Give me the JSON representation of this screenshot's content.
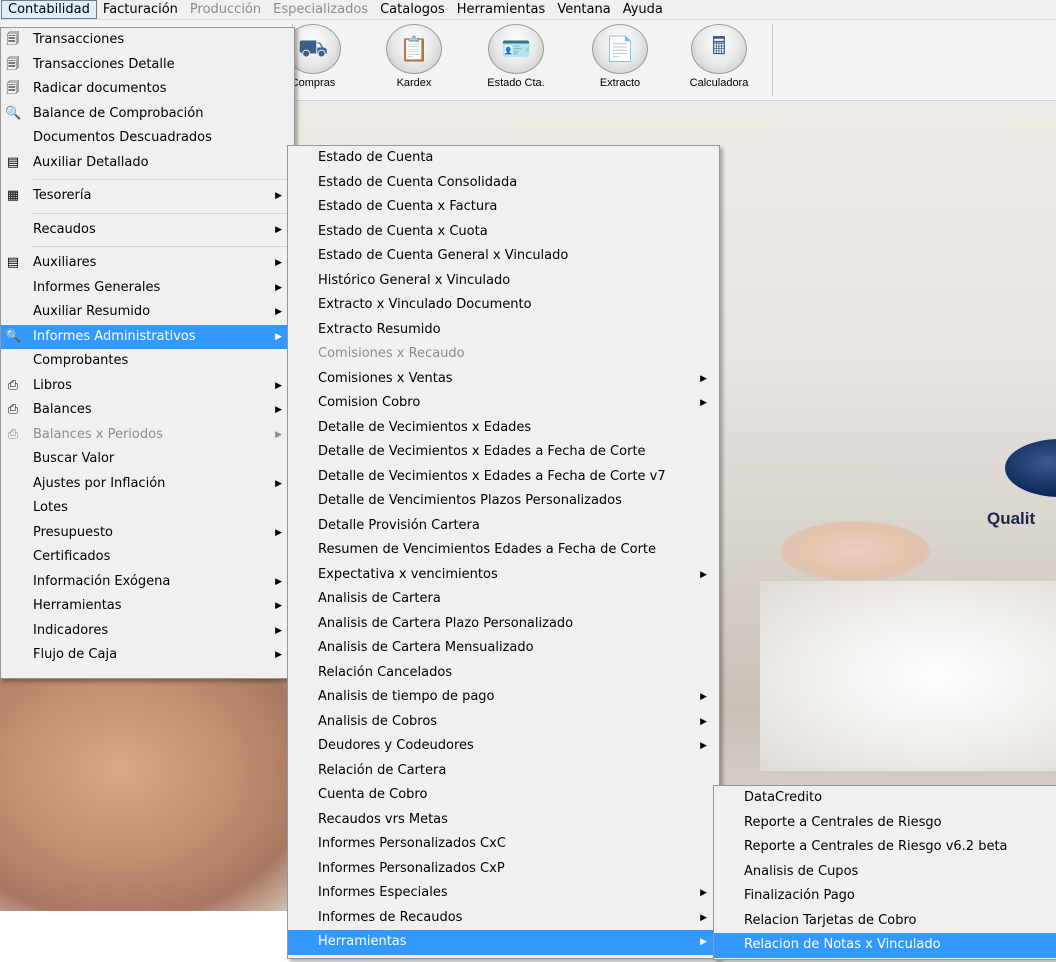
{
  "menubar": {
    "items": [
      {
        "label": "Contabilidad",
        "state": "active"
      },
      {
        "label": "Facturación",
        "state": "normal"
      },
      {
        "label": "Producción",
        "state": "disabled"
      },
      {
        "label": "Especializados",
        "state": "disabled"
      },
      {
        "label": "Catalogos",
        "state": "normal"
      },
      {
        "label": "Herramientas",
        "state": "normal"
      },
      {
        "label": "Ventana",
        "state": "normal"
      },
      {
        "label": "Ayuda",
        "state": "normal"
      }
    ]
  },
  "toolbar": {
    "buttons": [
      {
        "label": "Compras",
        "icon": "truck-icon"
      },
      {
        "label": "Kardex",
        "icon": "clipboard-add-icon"
      },
      {
        "label": "Estado Cta.",
        "icon": "id-card-icon"
      },
      {
        "label": "Extracto",
        "icon": "document-arrow-icon"
      },
      {
        "label": "Calculadora",
        "icon": "calculator-icon"
      }
    ]
  },
  "background": {
    "logo_text": "Qualit"
  },
  "menu_contabilidad": {
    "items": [
      {
        "label": "Transacciones",
        "icon": "transactions-icon"
      },
      {
        "label": "Transacciones Detalle",
        "icon": "transactions-icon"
      },
      {
        "label": "Radicar documentos",
        "icon": "transactions-icon"
      },
      {
        "label": "Balance de Comprobación",
        "icon": "magnifier-icon"
      },
      {
        "label": "Documentos Descuadrados"
      },
      {
        "label": "Auxiliar Detallado",
        "icon": "ledger-icon"
      },
      {
        "separator": true
      },
      {
        "label": "Tesorería",
        "icon": "treasury-icon",
        "submenu": true
      },
      {
        "separator": true
      },
      {
        "label": "Recaudos",
        "submenu": true
      },
      {
        "separator": true
      },
      {
        "label": "Auxiliares",
        "icon": "ledger-icon",
        "submenu": true
      },
      {
        "label": "Informes Generales",
        "submenu": true
      },
      {
        "label": "Auxiliar Resumido",
        "submenu": true
      },
      {
        "label": "Informes Administrativos",
        "icon": "magnifier-icon",
        "submenu": true,
        "highlight": true
      },
      {
        "label": "Comprobantes"
      },
      {
        "label": "Libros",
        "icon": "printer-icon",
        "submenu": true
      },
      {
        "label": "Balances",
        "icon": "printer-icon",
        "submenu": true
      },
      {
        "label": "Balances x Periodos",
        "icon": "printer-icon",
        "submenu": true,
        "disabled": true
      },
      {
        "label": "Buscar Valor"
      },
      {
        "label": "Ajustes por Inflación",
        "submenu": true
      },
      {
        "label": "Lotes"
      },
      {
        "label": "Presupuesto",
        "submenu": true
      },
      {
        "label": "Certificados"
      },
      {
        "label": "Información Exógena",
        "submenu": true
      },
      {
        "label": "Herramientas",
        "submenu": true
      },
      {
        "label": "Indicadores",
        "submenu": true
      },
      {
        "label": "Flujo de Caja",
        "submenu": true
      }
    ]
  },
  "menu_informes_administrativos": {
    "items": [
      {
        "label": "Estado de Cuenta"
      },
      {
        "label": "Estado de Cuenta Consolidada"
      },
      {
        "label": "Estado de Cuenta x Factura"
      },
      {
        "label": "Estado de Cuenta x Cuota"
      },
      {
        "label": "Estado de Cuenta General x Vinculado"
      },
      {
        "label": "Histórico General x Vinculado"
      },
      {
        "label": "Extracto x Vinculado Documento"
      },
      {
        "label": "Extracto Resumido"
      },
      {
        "label": "Comisiones x Recaudo",
        "disabled": true
      },
      {
        "label": "Comisiones x Ventas",
        "submenu": true
      },
      {
        "label": "Comision Cobro",
        "submenu": true
      },
      {
        "label": "Detalle de Vecimientos x Edades"
      },
      {
        "label": "Detalle de Vecimientos x Edades a Fecha de Corte"
      },
      {
        "label": "Detalle de Vecimientos x Edades a Fecha de Corte v7"
      },
      {
        "label": "Detalle de Vencimientos Plazos Personalizados"
      },
      {
        "label": "Detalle Provisión Cartera"
      },
      {
        "label": "Resumen de Vencimientos Edades a Fecha de Corte"
      },
      {
        "label": "Expectativa x vencimientos",
        "submenu": true
      },
      {
        "label": "Analisis de Cartera"
      },
      {
        "label": "Analisis de Cartera Plazo Personalizado"
      },
      {
        "label": "Analisis de Cartera Mensualizado"
      },
      {
        "label": "Relación Cancelados"
      },
      {
        "label": "Analisis de tiempo de pago",
        "submenu": true
      },
      {
        "label": "Analisis de Cobros",
        "submenu": true
      },
      {
        "label": "Deudores y Codeudores",
        "submenu": true
      },
      {
        "label": "Relación de Cartera"
      },
      {
        "label": "Cuenta de Cobro"
      },
      {
        "label": "Recaudos vrs Metas"
      },
      {
        "label": "Informes Personalizados CxC"
      },
      {
        "label": "Informes Personalizados CxP"
      },
      {
        "label": "Informes Especiales",
        "submenu": true
      },
      {
        "label": "Informes de Recaudos",
        "submenu": true
      },
      {
        "label": "Herramientas",
        "submenu": true,
        "highlight": true
      }
    ]
  },
  "menu_herramientas": {
    "items": [
      {
        "label": "DataCredito"
      },
      {
        "label": "Reporte a Centrales de Riesgo"
      },
      {
        "label": "Reporte a Centrales de Riesgo v6.2 beta"
      },
      {
        "label": "Analisis de Cupos"
      },
      {
        "label": "Finalización Pago"
      },
      {
        "label": "Relacion Tarjetas de Cobro"
      },
      {
        "label": "Relacion de Notas x Vinculado",
        "highlight": true
      }
    ]
  },
  "colors": {
    "highlight": "#3399ff",
    "menu_bg": "#f0f0f0",
    "disabled_text": "#8d8d8d"
  },
  "glyphs": {
    "submenu_arrow": "▶",
    "transactions-icon": "🗐",
    "magnifier-icon": "🔍",
    "ledger-icon": "▤",
    "treasury-icon": "▦",
    "printer-icon": "⎙",
    "truck-icon": "⛟",
    "clipboard-add-icon": "📋",
    "id-card-icon": "🪪",
    "document-arrow-icon": "📄",
    "calculator-icon": "🖩"
  }
}
